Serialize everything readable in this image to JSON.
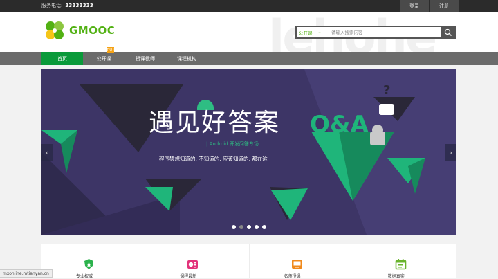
{
  "topbar": {
    "service_label": "服务电话:",
    "service_phone": "33333333",
    "login": "登录",
    "register": "注册"
  },
  "header": {
    "logo_text": "GMOOC",
    "background_text": "lehohe",
    "search": {
      "category": "公开课",
      "placeholder": "请输入搜索内容"
    }
  },
  "nav": {
    "items": [
      {
        "label": "首页"
      },
      {
        "label": "公开课"
      },
      {
        "label": "授课教师"
      },
      {
        "label": "课程机构"
      }
    ],
    "hot_badge": "HOT"
  },
  "banner": {
    "title": "遇见好答案",
    "subtitle": "| Android 开发问答专场 |",
    "description": "程序猿想知道的, 不知道的, 应该知道的, 都在这",
    "qa_text": "Q&A",
    "question_mark": "?",
    "prev": "‹",
    "next": "›",
    "slide_count": 5,
    "active_slide": 1
  },
  "features": [
    {
      "label": "专业权威",
      "icon": "shield-icon",
      "color": "#2bb24c"
    },
    {
      "label": "课程最新",
      "icon": "money-icon",
      "color": "#e2337a"
    },
    {
      "label": "名师授课",
      "icon": "teacher-icon",
      "color": "#f08a1c"
    },
    {
      "label": "数据真实",
      "icon": "calendar-icon",
      "color": "#6ab42e"
    }
  ],
  "status_text": "mxonline.mtianyan.cn",
  "colors": {
    "brand_green": "#52b113",
    "nav_active": "#0a9a3a",
    "banner_bg": "#3d3566",
    "accent_teal": "#2ebd83"
  }
}
